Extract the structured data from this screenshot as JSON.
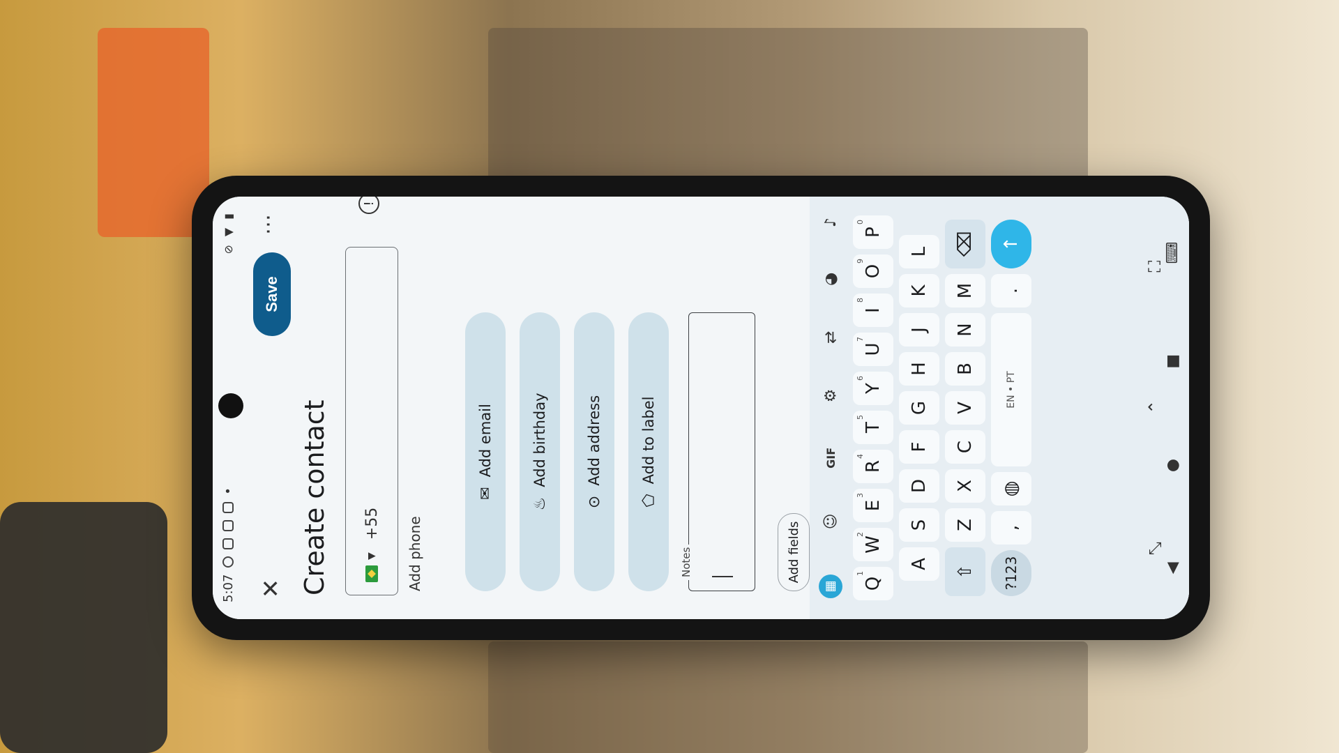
{
  "status_bar": {
    "time": "5:07"
  },
  "app_bar": {
    "close_icon": "close-icon",
    "save_label": "Save",
    "more_icon": "more-icon"
  },
  "page_title": "Create contact",
  "phone": {
    "country_code": "+55",
    "helper": "Add phone"
  },
  "chips": [
    {
      "label": "Add email",
      "icon": "email-icon"
    },
    {
      "label": "Add birthday",
      "icon": "cake-icon"
    },
    {
      "label": "Add address",
      "icon": "location-pin-icon"
    },
    {
      "label": "Add to label",
      "icon": "label-icon"
    }
  ],
  "notes": {
    "label": "Notes",
    "value": ""
  },
  "add_fields_label": "Add fields",
  "keyboard": {
    "toolbar": [
      "apps-icon",
      "sticker-icon",
      "gif-icon",
      "gear-icon",
      "translate-icon",
      "palette-icon",
      "mic-icon"
    ],
    "gif_label": "GIF",
    "row1": [
      "Q",
      "W",
      "E",
      "R",
      "T",
      "Y",
      "U",
      "I",
      "O",
      "P"
    ],
    "row1_sup": [
      "1",
      "2",
      "3",
      "4",
      "5",
      "6",
      "7",
      "8",
      "9",
      "0"
    ],
    "row2": [
      "A",
      "S",
      "D",
      "F",
      "G",
      "H",
      "J",
      "K",
      "L"
    ],
    "row3": [
      "Z",
      "X",
      "C",
      "V",
      "B",
      "N",
      "M"
    ],
    "sym_label": "?123",
    "space_label": "EN • PT",
    "comma": ",",
    "period": "."
  },
  "colors": {
    "accent": "#0f5c8c",
    "chip_bg": "#cfe1ea",
    "enter_key": "#2fb6e8"
  }
}
